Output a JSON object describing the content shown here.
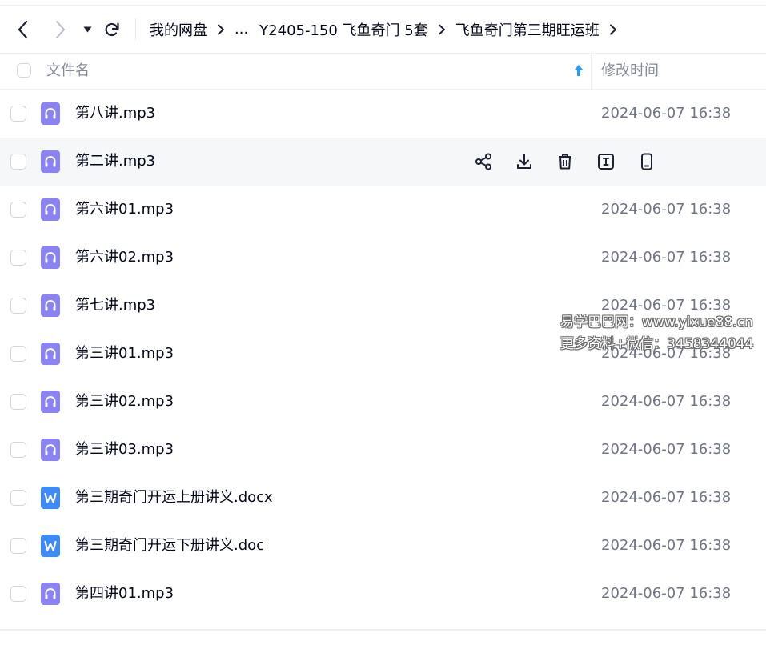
{
  "breadcrumb": {
    "items": [
      "我的网盘",
      "...",
      "Y2405-150 飞鱼奇门 5套",
      "飞鱼奇门第三期旺运班"
    ]
  },
  "header": {
    "name_label": "文件名",
    "time_label": "修改时间"
  },
  "files": [
    {
      "name": "第八讲.mp3",
      "time": "2024-06-07 16:38",
      "type": "audio"
    },
    {
      "name": "第二讲.mp3",
      "time": "",
      "type": "audio"
    },
    {
      "name": "第六讲01.mp3",
      "time": "2024-06-07 16:38",
      "type": "audio"
    },
    {
      "name": "第六讲02.mp3",
      "time": "2024-06-07 16:38",
      "type": "audio"
    },
    {
      "name": "第七讲.mp3",
      "time": "2024-06-07 16:38",
      "type": "audio"
    },
    {
      "name": "第三讲01.mp3",
      "time": "2024-06-07 16:38",
      "type": "audio"
    },
    {
      "name": "第三讲02.mp3",
      "time": "2024-06-07 16:38",
      "type": "audio"
    },
    {
      "name": "第三讲03.mp3",
      "time": "2024-06-07 16:38",
      "type": "audio"
    },
    {
      "name": "第三期奇门开运上册讲义.docx",
      "time": "2024-06-07 16:38",
      "type": "word"
    },
    {
      "name": "第三期奇门开运下册讲义.doc",
      "time": "2024-06-07 16:38",
      "type": "word"
    },
    {
      "name": "第四讲01.mp3",
      "time": "2024-06-07 16:38",
      "type": "audio"
    }
  ],
  "hover_actions": [
    "share-icon",
    "download-icon",
    "delete-icon",
    "rename-icon",
    "phone-icon"
  ],
  "watermark": {
    "line1": "易学巴巴网：www.yixue88.cn",
    "line2": "更多资料+微信：3458344044"
  },
  "colors": {
    "audio_icon": "#8b83f5",
    "word_icon": "#3d8bf8",
    "sort_arrow": "#2e9af2"
  }
}
